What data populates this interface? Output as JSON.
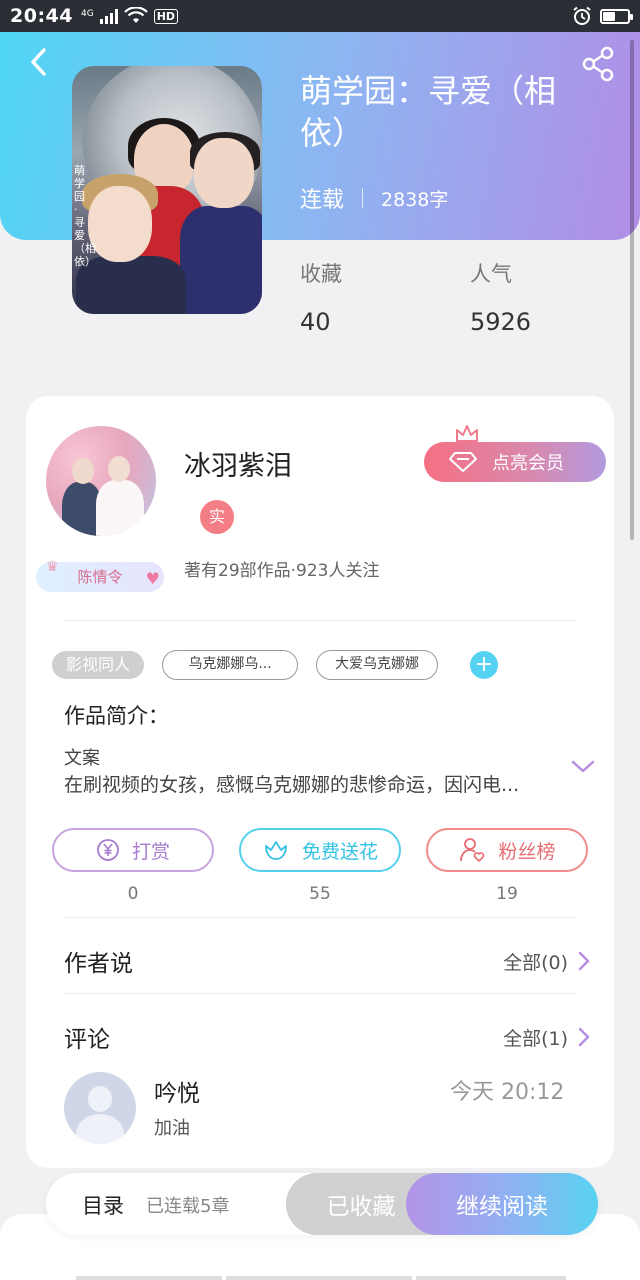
{
  "status_bar": {
    "time": "20:44",
    "network": "4G",
    "hd": "HD"
  },
  "book": {
    "title": "萌学园：寻爱（相依）",
    "status": "连载",
    "word_count": "2838字",
    "cover_text": "萌学园·寻爱（相依）",
    "stats": [
      {
        "label": "收藏",
        "value": "40"
      },
      {
        "label": "人气",
        "value": "5926"
      }
    ]
  },
  "author": {
    "name": "冰羽紫泪",
    "badge": "实",
    "stats": "著有29部作品·923人关注",
    "vip_tag": "陈情令",
    "member_button": "点亮会员"
  },
  "tags": {
    "genre": "影视同人",
    "items": [
      "乌克娜娜乌...",
      "大爱乌克娜娜"
    ],
    "add": "+"
  },
  "intro": {
    "heading": "作品简介：",
    "label": "文案",
    "text": "在刷视频的女孩，感慨乌克娜娜的悲惨命运，因闪电..."
  },
  "actions": [
    {
      "label": "打赏",
      "count": "0",
      "icon": "yen-coin-icon",
      "color": "#a67bd0"
    },
    {
      "label": "免费送花",
      "count": "55",
      "icon": "flower-icon",
      "color": "#34c2e4"
    },
    {
      "label": "粉丝榜",
      "count": "19",
      "icon": "fan-user-icon",
      "color": "#e86c72"
    }
  ],
  "author_says": {
    "title": "作者说",
    "more": "全部(0)"
  },
  "comments": {
    "title": "评论",
    "more": "全部(1)",
    "items": [
      {
        "user": "吟悦",
        "time": "今天 20:12",
        "text": "加油"
      }
    ]
  },
  "bottom_bar": {
    "toc": "目录",
    "chapters": "已连载5章",
    "collected": "已收藏",
    "continue": "继续阅读"
  },
  "colors": {
    "header_gradient_start": "#4fd6f5",
    "header_gradient_end": "#b28ee6",
    "accent_pink": "#f56f82",
    "accent_cyan": "#55d1f2"
  }
}
